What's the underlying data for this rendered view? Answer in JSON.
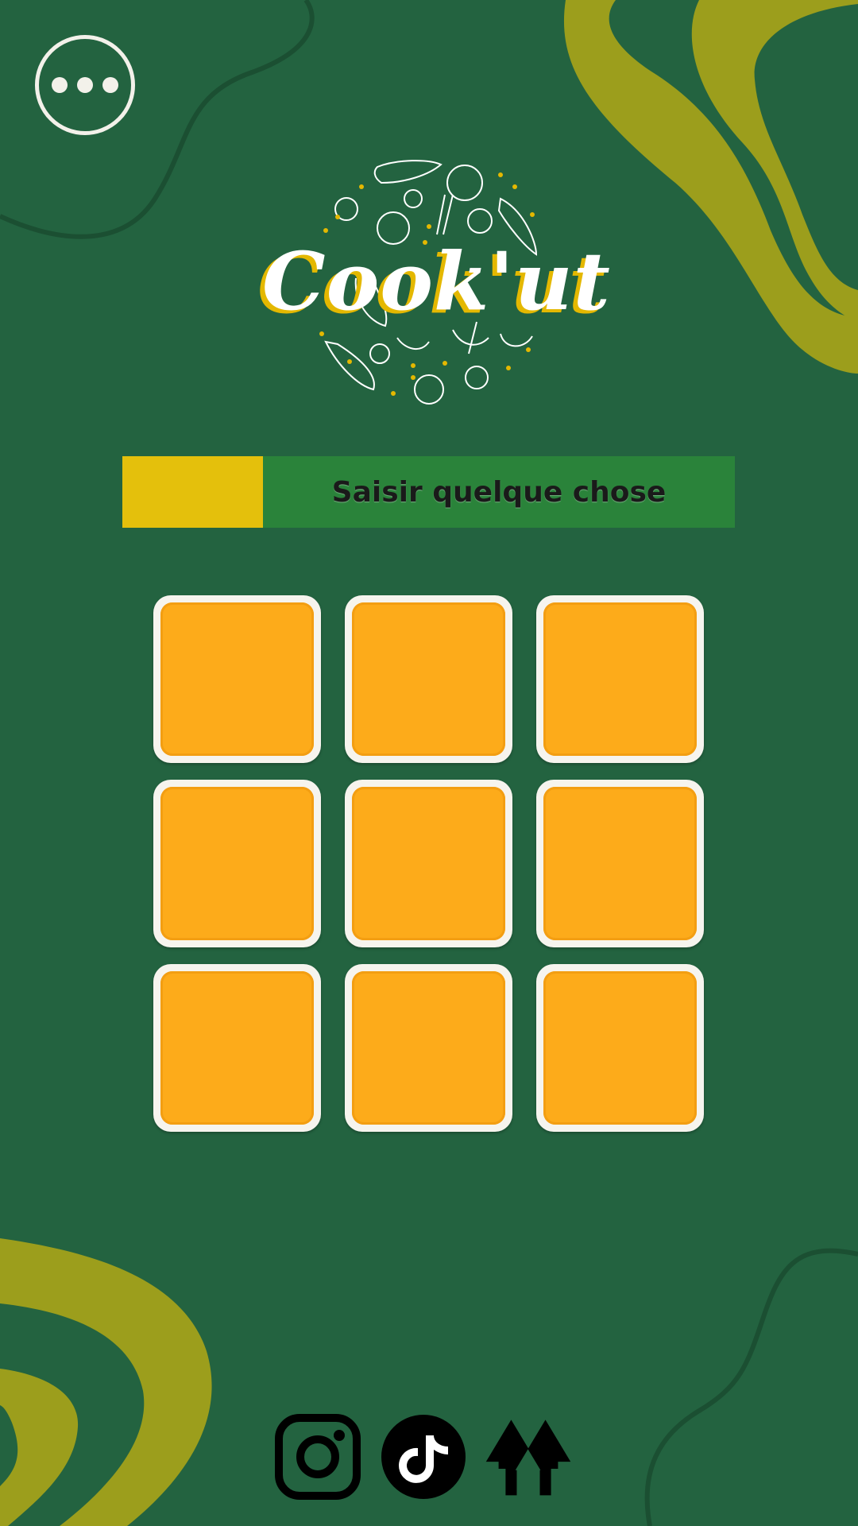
{
  "app": {
    "brand_name": "Cook'ut",
    "colors": {
      "background": "#236340",
      "accent_olive": "#9c9e1c",
      "accent_yellow": "#e4c00c",
      "tile_orange": "#fdab1a",
      "search_green": "#2a833a"
    }
  },
  "header": {
    "menu_icon": "more-horizontal-icon"
  },
  "search": {
    "placeholder": "Saisir quelque chose"
  },
  "grid": {
    "rows": 3,
    "columns": 3,
    "tiles": [
      "",
      "",
      "",
      "",
      "",
      "",
      "",
      "",
      ""
    ]
  },
  "footer": {
    "socials": [
      {
        "icon": "instagram-icon"
      },
      {
        "icon": "tiktok-icon"
      },
      {
        "icon": "linktree-icon"
      }
    ]
  }
}
